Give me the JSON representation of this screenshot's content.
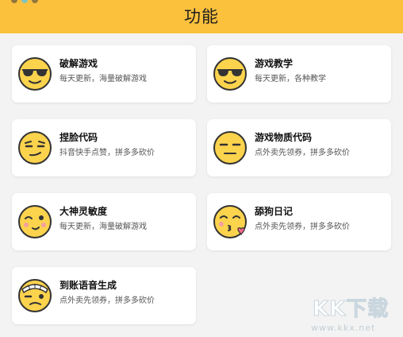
{
  "header": {
    "title": "功能"
  },
  "cards": [
    {
      "title": "破解游戏",
      "subtitle": "每天更新，海量破解游戏",
      "icon": "sunglasses-face-icon"
    },
    {
      "title": "游戏教学",
      "subtitle": "每天更新，各种教学",
      "icon": "sunglasses-face-icon"
    },
    {
      "title": "捏脸代码",
      "subtitle": "抖音快手点赞，拼多多砍价",
      "icon": "smirk-face-icon"
    },
    {
      "title": "游戏物质代码",
      "subtitle": "点外卖先领券，拼多多砍价",
      "icon": "expressionless-face-icon"
    },
    {
      "title": "大神灵敏度",
      "subtitle": "每天更新，海量破解游戏",
      "icon": "wink-face-icon"
    },
    {
      "title": "舔狗日记",
      "subtitle": "点外卖先领券，拼多多砍价",
      "icon": "kissing-heart-face-icon"
    },
    {
      "title": "到账语音生成",
      "subtitle": "点外卖先领券，拼多多砍价",
      "icon": "bandaged-face-icon"
    }
  ],
  "watermark": {
    "text": "KK下载",
    "url": "www.kkx.net"
  },
  "colors": {
    "header": "#fbc13d",
    "face": "#fcd34d",
    "background": "#f3f3f3"
  }
}
